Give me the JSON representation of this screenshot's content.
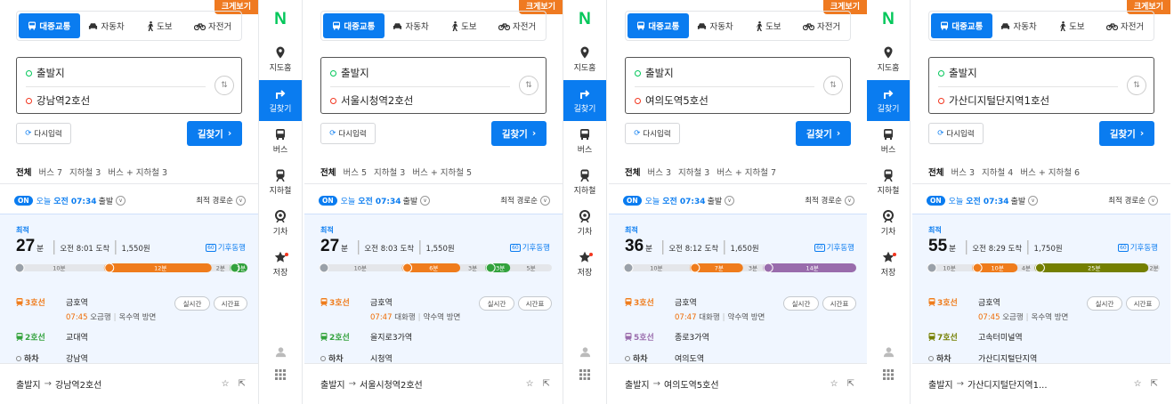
{
  "rail": {
    "logo": "N",
    "items": [
      {
        "label": "지도홈",
        "icon": "map-pin-icon",
        "active": false
      },
      {
        "label": "길찾기",
        "icon": "route-icon",
        "active": true
      },
      {
        "label": "버스",
        "icon": "bus-icon",
        "active": false
      },
      {
        "label": "지하철",
        "icon": "subway-icon",
        "active": false
      },
      {
        "label": "기차",
        "icon": "train-icon",
        "active": false
      },
      {
        "label": "저장",
        "icon": "star-icon",
        "active": false
      }
    ],
    "bottom_icons": [
      "user-icon",
      "grid-icon"
    ]
  },
  "common": {
    "bigview": "크게보기",
    "modes": [
      {
        "label": "대중교통",
        "icon": "bus-icon"
      },
      {
        "label": "자동차",
        "icon": "car-icon"
      },
      {
        "label": "도보",
        "icon": "walk-icon"
      },
      {
        "label": "자전거",
        "icon": "bike-icon"
      }
    ],
    "origin": "출발지",
    "reinput": "다시입력",
    "find": "길찾기",
    "filter_all": "전체",
    "on_badge": "ON",
    "today": "오늘",
    "time": "오전 07:34",
    "depart": "출발",
    "sort": "최적 경로순",
    "best": "최적",
    "min_unit": "분",
    "climate": "기후동행",
    "climate_badge": "60",
    "realtime": "실시간",
    "timetable": "시간표",
    "getoff": "하차",
    "arrow": "→"
  },
  "colors": {
    "accent": "#0a7cf0",
    "line2": "#33a23d",
    "line3": "#ef7c1c",
    "line5": "#996cac",
    "line7": "#747f00",
    "walk": "#9aa1a9",
    "logo": "#03c75a",
    "bigview": "#ef7a21"
  },
  "panels": [
    {
      "destination": "강남역2호선",
      "filters": {
        "bus": "버스 7",
        "subway": "지하철 3",
        "mixed": "버스 + 지하철 3"
      },
      "duration": "27",
      "arrival": "오전 8:01 도착",
      "fare": "1,550원",
      "segments": [
        {
          "type": "walk",
          "label": "10분",
          "weight": 10
        },
        {
          "type": "line3",
          "label": "12분",
          "weight": 12
        },
        {
          "type": "walk",
          "label": "2분",
          "weight": 2
        },
        {
          "type": "line2",
          "label": "1분",
          "weight": 2
        }
      ],
      "board_line": "3호선",
      "board_station": "금호역",
      "board_arrival": "07:45",
      "board_dir_a": "오금행",
      "board_dir_b": "옥수역 방면",
      "transfer_line": "2호선",
      "transfer_color": "line2",
      "transfer_station": "교대역",
      "getoff_station": "강남역",
      "footer_dest": "강남역2호선"
    },
    {
      "destination": "서울시청역2호선",
      "filters": {
        "bus": "버스 5",
        "subway": "지하철 3",
        "mixed": "버스 + 지하철 5"
      },
      "duration": "27",
      "arrival": "오전 8:03 도착",
      "fare": "1,550원",
      "segments": [
        {
          "type": "walk",
          "label": "10분",
          "weight": 10
        },
        {
          "type": "line3",
          "label": "6분",
          "weight": 7
        },
        {
          "type": "walk",
          "label": "3분",
          "weight": 3
        },
        {
          "type": "line2",
          "label": "3분",
          "weight": 3
        },
        {
          "type": "walk",
          "label": "5분",
          "weight": 5
        }
      ],
      "board_line": "3호선",
      "board_station": "금호역",
      "board_arrival": "07:47",
      "board_dir_a": "대화행",
      "board_dir_b": "약수역 방면",
      "transfer_line": "2호선",
      "transfer_color": "line2",
      "transfer_station": "을지로3가역",
      "getoff_station": "시청역",
      "footer_dest": "서울시청역2호선"
    },
    {
      "destination": "여의도역5호선",
      "filters": {
        "bus": "버스 3",
        "subway": "지하철 3",
        "mixed": "버스 + 지하철 7"
      },
      "duration": "36",
      "arrival": "오전 8:12 도착",
      "fare": "1,650원",
      "segments": [
        {
          "type": "walk",
          "label": "10분",
          "weight": 10
        },
        {
          "type": "line3",
          "label": "7분",
          "weight": 8
        },
        {
          "type": "walk",
          "label": "3분",
          "weight": 3
        },
        {
          "type": "line5",
          "label": "14분",
          "weight": 14
        }
      ],
      "board_line": "3호선",
      "board_station": "금호역",
      "board_arrival": "07:47",
      "board_dir_a": "대화행",
      "board_dir_b": "약수역 방면",
      "transfer_line": "5호선",
      "transfer_color": "line5",
      "transfer_station": "종로3가역",
      "getoff_station": "여의도역",
      "footer_dest": "여의도역5호선"
    },
    {
      "destination": "가산디지털단지역1호선",
      "filters": {
        "bus": "버스 3",
        "subway": "지하철 4",
        "mixed": "버스 + 지하철 6"
      },
      "duration": "55",
      "arrival": "오전 8:29 도착",
      "fare": "1,750원",
      "segments": [
        {
          "type": "walk",
          "label": "10분",
          "weight": 8
        },
        {
          "type": "line3",
          "label": "10분",
          "weight": 8
        },
        {
          "type": "walk",
          "label": "4분",
          "weight": 3
        },
        {
          "type": "line7",
          "label": "25분",
          "weight": 20
        },
        {
          "type": "walk",
          "label": "2분",
          "weight": 2
        }
      ],
      "board_line": "3호선",
      "board_station": "금호역",
      "board_arrival": "07:45",
      "board_dir_a": "오금행",
      "board_dir_b": "옥수역 방면",
      "transfer_line": "7호선",
      "transfer_color": "line7",
      "transfer_station": "고속터미널역",
      "getoff_station": "가산디지털단지역",
      "footer_dest": "가산디지털단지역1..."
    }
  ]
}
